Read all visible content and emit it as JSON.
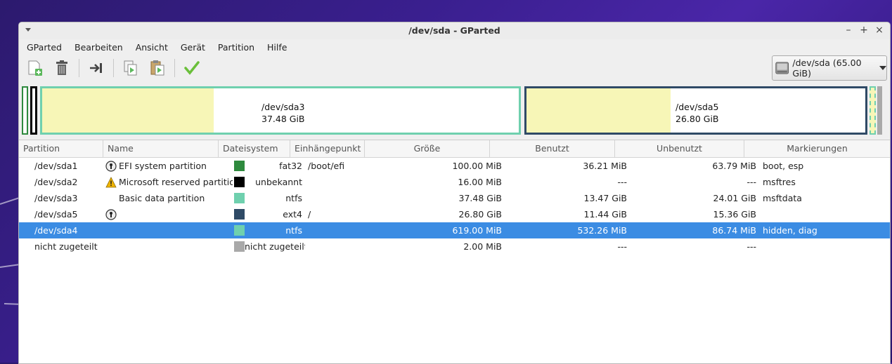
{
  "window": {
    "title": "/dev/sda - GParted",
    "controls": [
      "–",
      "+",
      "×"
    ]
  },
  "menu": [
    "GParted",
    "Bearbeiten",
    "Ansicht",
    "Gerät",
    "Partition",
    "Hilfe"
  ],
  "device": {
    "label": "/dev/sda (65.00 GiB)"
  },
  "diskmap": {
    "sda3": {
      "name": "/dev/sda3",
      "size": "37.48 GiB"
    },
    "sda5": {
      "name": "/dev/sda5",
      "size": "26.80 GiB"
    }
  },
  "columns": [
    "Partition",
    "Name",
    "Dateisystem",
    "Einhängepunkt",
    "Größe",
    "Benutzt",
    "Unbenutzt",
    "Markierungen"
  ],
  "colors": {
    "fat32": "#2e8a3e",
    "unknown": "#000000",
    "ntfs": "#6fd0ae",
    "ext4": "#2f4a66",
    "unallocated": "#a9a9a9",
    "selection": "#3b8ce3"
  },
  "rows": [
    {
      "partition": "/dev/sda1",
      "icon": "key-icon",
      "name": "EFI system partition",
      "fs": "fat32",
      "fs_color": "#2e8a3e",
      "mount": "/boot/efi",
      "size": "100.00 MiB",
      "used": "36.21 MiB",
      "unused": "63.79 MiB",
      "flags": "boot, esp"
    },
    {
      "partition": "/dev/sda2",
      "icon": "warning-icon",
      "name": "Microsoft reserved partition",
      "fs": "unbekannt",
      "fs_color": "#000000",
      "mount": "",
      "size": "16.00 MiB",
      "used": "---",
      "unused": "---",
      "flags": "msftres"
    },
    {
      "partition": "/dev/sda3",
      "icon": "",
      "name": "Basic data partition",
      "fs": "ntfs",
      "fs_color": "#6fd0ae",
      "mount": "",
      "size": "37.48 GiB",
      "used": "13.47 GiB",
      "unused": "24.01 GiB",
      "flags": "msftdata"
    },
    {
      "partition": "/dev/sda5",
      "icon": "key-icon",
      "name": "",
      "fs": "ext4",
      "fs_color": "#2f4a66",
      "mount": "/",
      "size": "26.80 GiB",
      "used": "11.44 GiB",
      "unused": "15.36 GiB",
      "flags": ""
    },
    {
      "partition": "/dev/sda4",
      "icon": "",
      "name": "",
      "fs": "ntfs",
      "fs_color": "#6fd0ae",
      "mount": "",
      "size": "619.00 MiB",
      "used": "532.26 MiB",
      "unused": "86.74 MiB",
      "flags": "hidden, diag",
      "selected": true
    },
    {
      "partition": "nicht zugeteilt",
      "icon": "",
      "name": "",
      "fs": "nicht zugeteilt",
      "fs_color": "#a9a9a9",
      "mount": "",
      "size": "2.00 MiB",
      "used": "---",
      "unused": "---",
      "flags": ""
    }
  ]
}
